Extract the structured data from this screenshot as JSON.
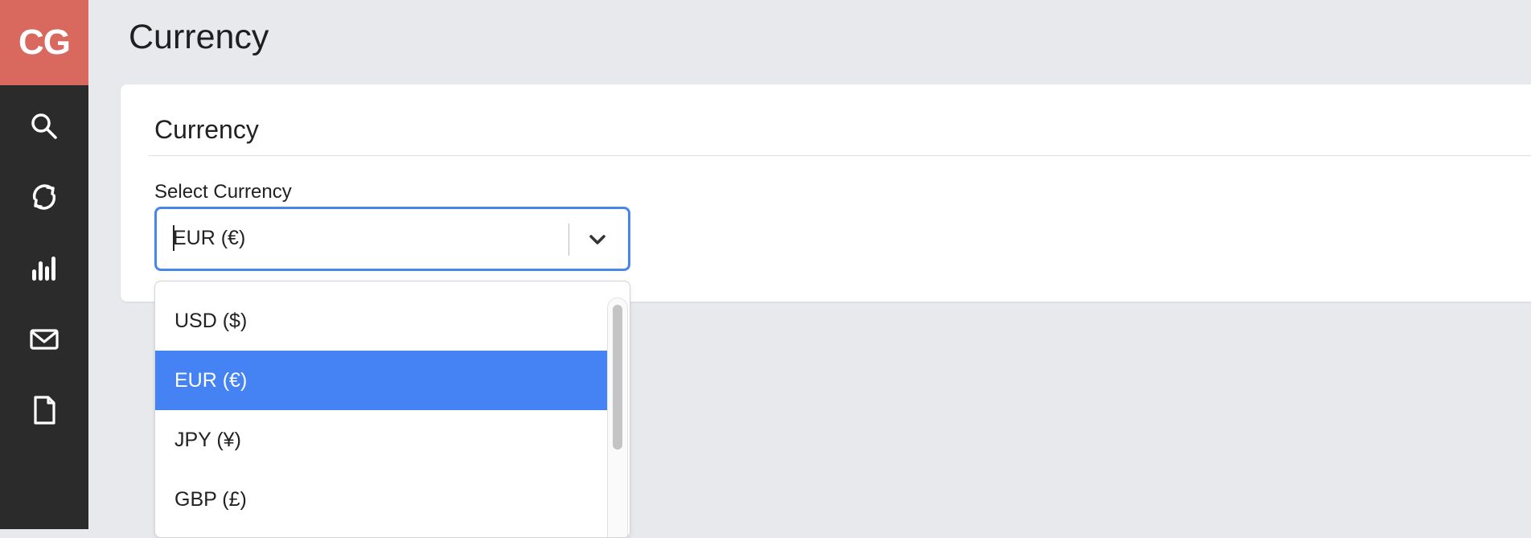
{
  "sidebar": {
    "logo": "CG",
    "icons": [
      "search-icon",
      "refresh-icon",
      "bar-chart-icon",
      "mail-icon",
      "document-icon"
    ]
  },
  "page": {
    "title": "Currency"
  },
  "card": {
    "title": "Currency",
    "field_label": "Select Currency",
    "selected_value": "EUR (€)"
  },
  "dropdown": {
    "options": [
      "USD ($)",
      "EUR (€)",
      "JPY (¥)",
      "GBP (£)"
    ],
    "selected_index": 1
  },
  "colors": {
    "logo_bg": "#d9695f",
    "sidebar_bg": "#2b2b2b",
    "accent": "#4582f3",
    "focus_border": "#4a86e8"
  }
}
